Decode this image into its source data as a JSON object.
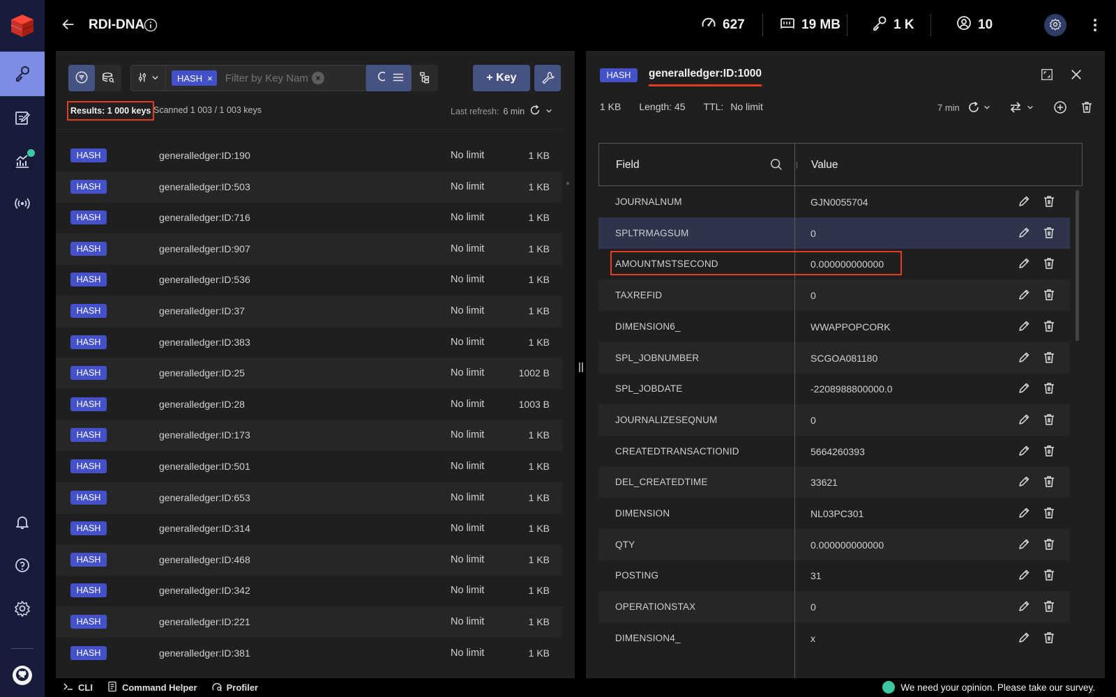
{
  "app": {
    "db_name": "RDI-DNA",
    "brand_color": "#dc382c",
    "accent_color": "#465282",
    "badge_color": "#4451c8",
    "highlight_color": "#e33d1f"
  },
  "sidebar": {
    "items": [
      {
        "icon": "key-icon",
        "active": true
      },
      {
        "icon": "workbench-icon"
      },
      {
        "icon": "analytics-icon"
      },
      {
        "icon": "pubsub-icon"
      }
    ],
    "bottom": [
      {
        "icon": "bell-icon"
      },
      {
        "icon": "help-icon"
      },
      {
        "icon": "gear-icon"
      },
      {
        "icon": "github-icon"
      }
    ]
  },
  "topbar": {
    "stats": {
      "ops": "627",
      "memory": "19 MB",
      "keys": "1 K",
      "clients": "10"
    }
  },
  "browser": {
    "filter_chip": "HASH",
    "chip_close": "×",
    "filter_placeholder": "Filter by Key Nam",
    "add_key_label": "+ Key",
    "results_text": "Results: 1 000 keys",
    "scanned_text": "Scanned 1 003 / 1 003 keys",
    "last_refresh_label": "Last refresh:",
    "last_refresh_value": "6 min",
    "keys": [
      {
        "type": "HASH",
        "name": "generalledger:ID:190",
        "ttl": "No limit",
        "size": "1 KB"
      },
      {
        "type": "HASH",
        "name": "generalledger:ID:503",
        "ttl": "No limit",
        "size": "1 KB"
      },
      {
        "type": "HASH",
        "name": "generalledger:ID:716",
        "ttl": "No limit",
        "size": "1 KB"
      },
      {
        "type": "HASH",
        "name": "generalledger:ID:907",
        "ttl": "No limit",
        "size": "1 KB"
      },
      {
        "type": "HASH",
        "name": "generalledger:ID:536",
        "ttl": "No limit",
        "size": "1 KB"
      },
      {
        "type": "HASH",
        "name": "generalledger:ID:37",
        "ttl": "No limit",
        "size": "1 KB"
      },
      {
        "type": "HASH",
        "name": "generalledger:ID:383",
        "ttl": "No limit",
        "size": "1 KB"
      },
      {
        "type": "HASH",
        "name": "generalledger:ID:25",
        "ttl": "No limit",
        "size": "1002 B"
      },
      {
        "type": "HASH",
        "name": "generalledger:ID:28",
        "ttl": "No limit",
        "size": "1003 B"
      },
      {
        "type": "HASH",
        "name": "generalledger:ID:173",
        "ttl": "No limit",
        "size": "1 KB"
      },
      {
        "type": "HASH",
        "name": "generalledger:ID:501",
        "ttl": "No limit",
        "size": "1 KB"
      },
      {
        "type": "HASH",
        "name": "generalledger:ID:653",
        "ttl": "No limit",
        "size": "1 KB"
      },
      {
        "type": "HASH",
        "name": "generalledger:ID:314",
        "ttl": "No limit",
        "size": "1 KB"
      },
      {
        "type": "HASH",
        "name": "generalledger:ID:468",
        "ttl": "No limit",
        "size": "1 KB"
      },
      {
        "type": "HASH",
        "name": "generalledger:ID:342",
        "ttl": "No limit",
        "size": "1 KB"
      },
      {
        "type": "HASH",
        "name": "generalledger:ID:221",
        "ttl": "No limit",
        "size": "1 KB"
      },
      {
        "type": "HASH",
        "name": "generalledger:ID:381",
        "ttl": "No limit",
        "size": "1 KB"
      }
    ]
  },
  "details": {
    "type": "HASH",
    "key_name": "generalledger:ID:1000",
    "size": "1 KB",
    "length": "Length: 45",
    "ttl_label": "TTL:",
    "ttl_value": "No limit",
    "refresh_ago": "7 min",
    "columns": {
      "field": "Field",
      "value": "Value"
    },
    "fields": [
      {
        "field": "JOURNALNUM",
        "value": "GJN0055704"
      },
      {
        "field": "SPLTRMAGSUM",
        "value": "0"
      },
      {
        "field": "AMOUNTMSTSECOND",
        "value": "0.000000000000"
      },
      {
        "field": "TAXREFID",
        "value": "0"
      },
      {
        "field": "DIMENSION6_",
        "value": "WWAPPOPCORK"
      },
      {
        "field": "SPL_JOBNUMBER",
        "value": "SCGOA081180"
      },
      {
        "field": "SPL_JOBDATE",
        "value": "-2208988800000.0"
      },
      {
        "field": "JOURNALIZESEQNUM",
        "value": "0"
      },
      {
        "field": "CREATEDTRANSACTIONID",
        "value": "5664260393"
      },
      {
        "field": "DEL_CREATEDTIME",
        "value": "33621"
      },
      {
        "field": "DIMENSION",
        "value": "NL03PC301"
      },
      {
        "field": "QTY",
        "value": "0.000000000000"
      },
      {
        "field": "POSTING",
        "value": "31"
      },
      {
        "field": "OPERATIONSTAX",
        "value": "0"
      },
      {
        "field": "DIMENSION4_",
        "value": "x"
      }
    ]
  },
  "bottombar": {
    "cli": "CLI",
    "command_helper": "Command Helper",
    "profiler": "Profiler",
    "survey": "We need your opinion. Please take our survey."
  }
}
